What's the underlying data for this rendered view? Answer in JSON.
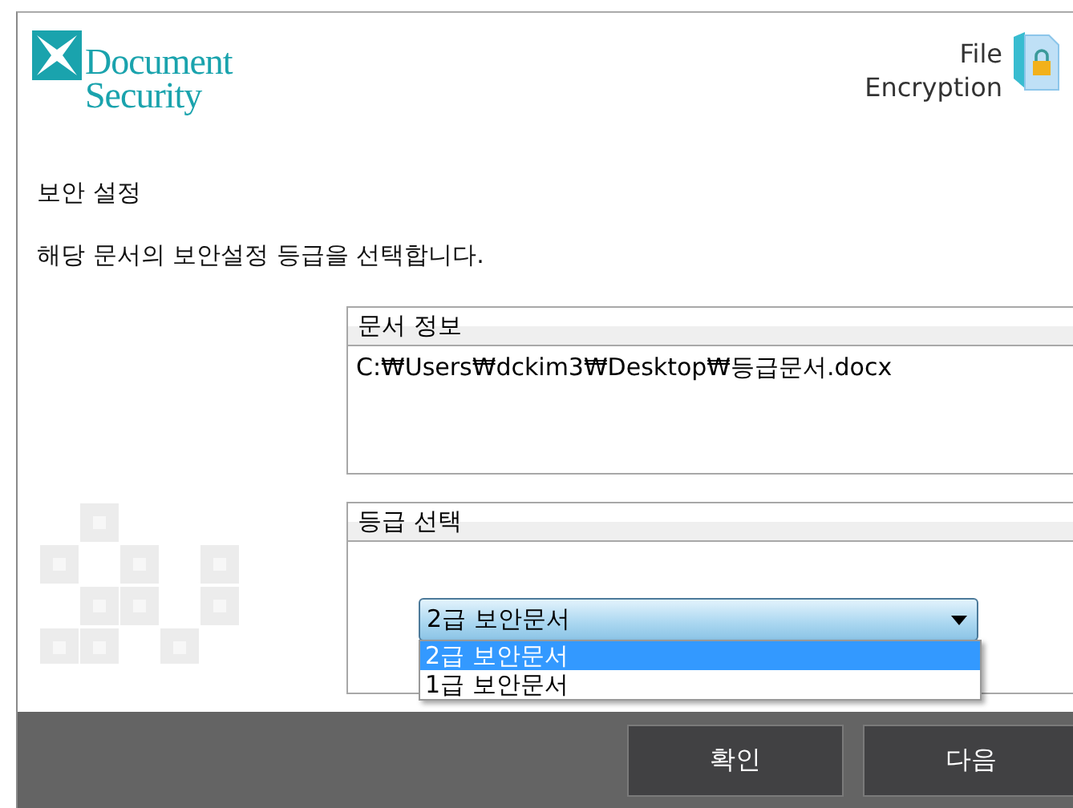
{
  "logo": {
    "line_1": "Document",
    "line_2": "Security"
  },
  "product": {
    "line_1": "File",
    "line_2": "Encryption"
  },
  "title": "보안 설정",
  "description": "해당 문서의 보안설정 등급을 선택합니다.",
  "document_info": {
    "heading": "문서 정보",
    "path": "C:₩Users₩dckim3₩Desktop₩등급문서.docx"
  },
  "grade_select": {
    "heading": "등급 선택",
    "value": "2급 보안문서",
    "expanded": true,
    "options": [
      {
        "label": "2급 보안문서",
        "selected": true
      },
      {
        "label": "1급 보안문서",
        "selected": false
      }
    ]
  },
  "buttons": [
    "확인",
    "다음"
  ]
}
